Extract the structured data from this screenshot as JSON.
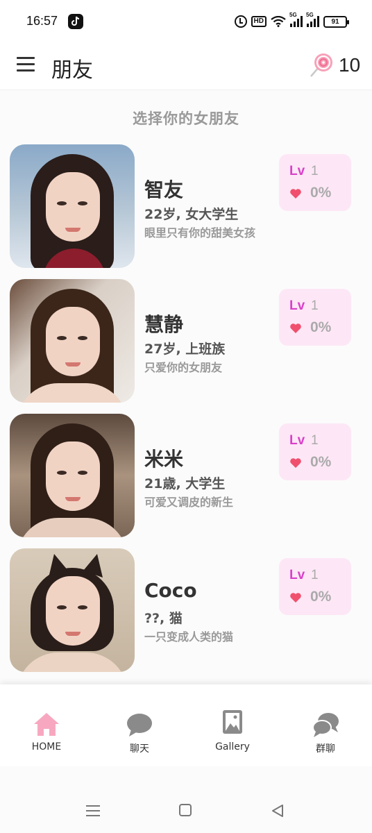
{
  "status_bar": {
    "time": "16:57",
    "hd_label": "HD",
    "signal_1": "5G",
    "signal_2": "5G",
    "battery": "91",
    "icons": [
      "tiktok-icon",
      "alarm-icon",
      "hd-icon",
      "wifi-icon",
      "signal-icon",
      "signal-icon",
      "battery-icon"
    ]
  },
  "app_bar": {
    "title": "朋友",
    "candy_count": "10"
  },
  "section_title": "选择你的女朋友",
  "friends": [
    {
      "name": "智友",
      "meta": "22岁, 女大学生",
      "tagline": "眼里只有你的甜美女孩",
      "lv_label": "Lv",
      "level": "1",
      "affinity": "0%"
    },
    {
      "name": "慧静",
      "meta": "27岁, 上班族",
      "tagline": "只爱你的女朋友",
      "lv_label": "Lv",
      "level": "1",
      "affinity": "0%"
    },
    {
      "name": "米米",
      "meta": "21歳, 大学生",
      "tagline": "可爱又调皮的新生",
      "lv_label": "Lv",
      "level": "1",
      "affinity": "0%"
    },
    {
      "name": "Coco",
      "meta": "??, 猫",
      "tagline": "一只变成人类的猫",
      "lv_label": "Lv",
      "level": "1",
      "affinity": "0%"
    }
  ],
  "bottom_nav": [
    {
      "label": "HOME",
      "icon": "home-icon",
      "active": true
    },
    {
      "label": "聊天",
      "icon": "chat-bubble-icon",
      "active": false
    },
    {
      "label": "Gallery",
      "icon": "gallery-icon",
      "active": false
    },
    {
      "label": "群聊",
      "icon": "group-chat-icon",
      "active": false
    }
  ],
  "colors": {
    "accent": "#d940c9",
    "badge_bg": "#fde7f6",
    "heart": "#f0506e",
    "home_active": "#f7a8c0",
    "nav_inactive": "#8a8a8a"
  }
}
